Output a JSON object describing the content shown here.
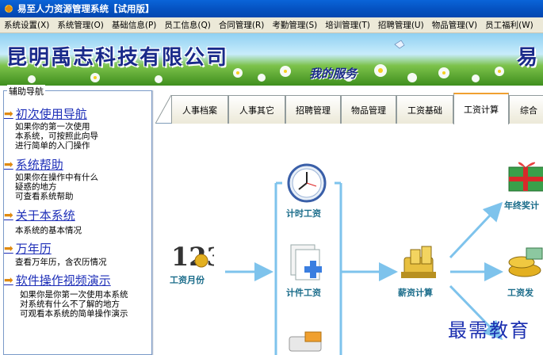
{
  "window": {
    "title": "易至人力资源管理系统【试用版】"
  },
  "menu": [
    "系统设置(X)",
    "系统管理(O)",
    "基础信息(P)",
    "员工信息(Q)",
    "合同管理(R)",
    "考勤管理(S)",
    "培训管理(T)",
    "招聘管理(U)",
    "物品管理(V)",
    "员工福利(W)"
  ],
  "banner": {
    "company": "昆明禹志科技有限公司",
    "company_tail": "易",
    "slogan": "我的服务"
  },
  "side": {
    "legend": "辅助导航",
    "items": [
      {
        "label": "初次使用导航",
        "desc": [
          "如果你的第一次使用",
          "本系统，可按照此向导",
          "进行简单的入门操作"
        ]
      },
      {
        "label": "系统帮助",
        "desc": [
          "如果你在操作中有什么",
          "疑惑的地方",
          "可查看系统帮助"
        ]
      },
      {
        "label": "关于本系统",
        "desc": [
          "本系统的基本情况"
        ]
      },
      {
        "label": "万年历",
        "desc": [
          "查看万年历，含农历情况"
        ]
      },
      {
        "label": "软件操作视频演示",
        "desc": [
          "如果你是你第一次使用本系统",
          "对系统有什么不了解的地方",
          "可观看本系统的简单操作演示"
        ]
      }
    ]
  },
  "tabs": [
    "人事档案",
    "人事其它",
    "招聘管理",
    "物品管理",
    "工资基础",
    "工资计算",
    "综合"
  ],
  "active_tab": "工资计算",
  "diagram": {
    "nodes": {
      "month": "工资月份",
      "timed": "计时工资",
      "piece": "计件工资",
      "calc": "薪资计算",
      "bonus": "年终奖计",
      "issue": "工资发"
    },
    "month_glyph": "123"
  },
  "watermark": "最需教育",
  "colors": {
    "titlebar": "#0553c2",
    "link": "#1e2fb8",
    "arrow": "#7ec3ec",
    "accent": "#f0a030"
  }
}
